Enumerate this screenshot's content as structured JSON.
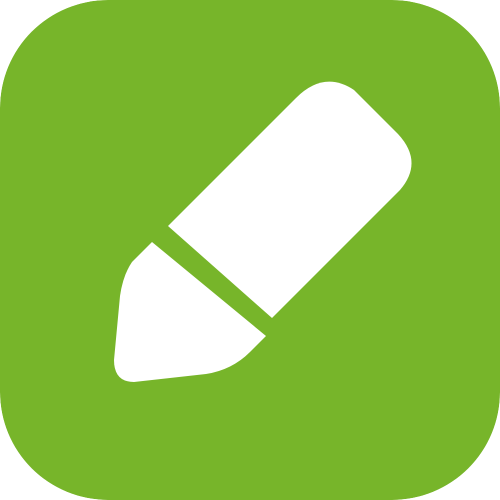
{
  "icon": {
    "name": "pencil-edit-icon",
    "background_color": "#77B52A",
    "glyph_color": "#FFFFFF"
  }
}
